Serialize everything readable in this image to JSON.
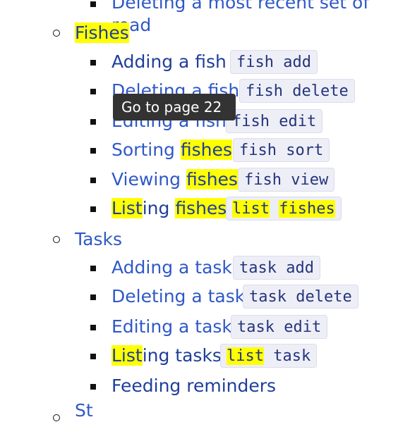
{
  "top_item": {
    "text": "Deleting a most recent set of read"
  },
  "sections": [
    {
      "title_hl": "Fishes",
      "items": [
        {
          "label": "Adding a fish",
          "code": [
            "fish add"
          ]
        },
        {
          "label": "Deleting a fish",
          "code": [
            "fish delete"
          ]
        },
        {
          "label": "Editing a fish",
          "code": [
            "fish edit"
          ]
        },
        {
          "label_plain": "Sorting ",
          "label_hl": "fishes",
          "code": [
            "fish sort"
          ]
        },
        {
          "label_plain": "Viewing ",
          "label_hl": "fishes",
          "code": [
            "fish view"
          ]
        },
        {
          "label_hl1": "List",
          "label_mid": "ing ",
          "label_hl2": "fishes",
          "code_hl1": "list",
          "code_sp": " ",
          "code_hl2": "fishes"
        }
      ]
    },
    {
      "title": "Tasks",
      "items": [
        {
          "label": "Adding a task",
          "code": [
            "task add"
          ]
        },
        {
          "label": "Deleting a task",
          "code": [
            "task delete"
          ]
        },
        {
          "label": "Editing a task",
          "code": [
            "task edit"
          ]
        },
        {
          "label_hl": "List",
          "label_rest": "ing tasks",
          "code_hl": "list",
          "code_rest": " task"
        },
        {
          "label": "Feeding reminders"
        }
      ]
    }
  ],
  "next_section_partial": "St",
  "tooltip": {
    "text": "Go to page 22"
  }
}
